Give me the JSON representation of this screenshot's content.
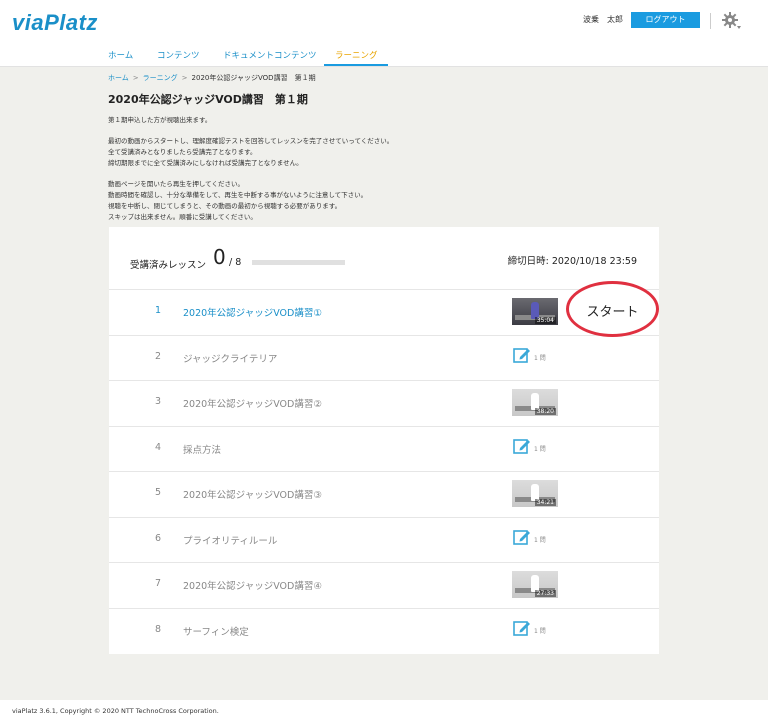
{
  "header": {
    "logo": "viaPlatz",
    "user_name": "波乗　太郎",
    "logout_label": "ログアウト"
  },
  "nav": {
    "tabs": [
      {
        "label": "ホーム"
      },
      {
        "label": "コンテンツ"
      },
      {
        "label": "ドキュメントコンテンツ"
      },
      {
        "label": "ラーニング"
      }
    ],
    "active_tab": "ラーニング"
  },
  "breadcrumb": {
    "home": "ホーム",
    "separator": ">",
    "learning": "ラーニング",
    "current": "2020年公認ジャッジVOD講習　第１期"
  },
  "page": {
    "title": "2020年公認ジャッジVOD講習　第１期",
    "description": [
      "第１期申込した方が視聴出来ます。",
      "最初の動画からスタートし、理解度確認テストを回答してレッスンを完了させていってください。",
      "全て受講済みとなりましたら受講完了となります。",
      "締切期限までに全て受講済みにしなければ受講完了となりません。",
      "動画ページを開いたら再生を押してください。",
      "動画時間を確認し、十分な準備をして、再生を中断する事がないように注意して下さい。",
      "視聴を中断し、閉じてしまうと、その動画の最初から視聴する必要があります。",
      "スキップは出来ません。順番に受講してください。"
    ]
  },
  "progress": {
    "label": "受講済みレッスン",
    "completed": "0",
    "total": "/ 8",
    "fraction": 0,
    "deadline": "締切日時: 2020/10/18 23:59"
  },
  "lessons": [
    {
      "num": "1",
      "title": "2020年公認ジャッジVOD講習①",
      "kind": "video",
      "duration": "35:04"
    },
    {
      "num": "2",
      "title": "ジャッジクライテリア",
      "kind": "quiz",
      "count": "1 問"
    },
    {
      "num": "3",
      "title": "2020年公認ジャッジVOD講習②",
      "kind": "video",
      "duration": "38:20"
    },
    {
      "num": "4",
      "title": "採点方法",
      "kind": "quiz",
      "count": "1 問"
    },
    {
      "num": "5",
      "title": "2020年公認ジャッジVOD講習③",
      "kind": "video",
      "duration": "34:21"
    },
    {
      "num": "6",
      "title": "プライオリティルール",
      "kind": "quiz",
      "count": "1 問"
    },
    {
      "num": "7",
      "title": "2020年公認ジャッジVOD講習④",
      "kind": "video",
      "duration": "27:33"
    },
    {
      "num": "8",
      "title": "サーフィン検定",
      "kind": "quiz",
      "count": "1 問"
    }
  ],
  "start_button": "スタート",
  "footer": "viaPlatz 3.6.1, Copyright © 2020 NTT TechnoCross Corporation.",
  "colors": {
    "accent": "#1a9be0",
    "active_tab": "#e8a400",
    "highlight_ring": "#e03040",
    "quiz_icon": "#3aa8d8"
  },
  "icons": {
    "settings": "gear-icon",
    "quiz": "edit-note-icon"
  }
}
